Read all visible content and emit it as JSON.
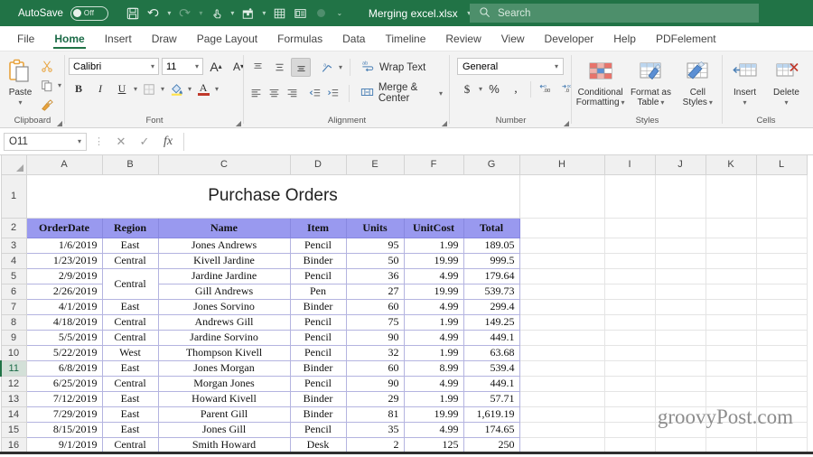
{
  "titlebar": {
    "autosave_label": "AutoSave",
    "autosave_state": "Off",
    "document_title": "Merging excel.xlsx",
    "quick_access": [
      {
        "name": "save-icon",
        "glyph": "὚B"
      },
      {
        "name": "undo-icon",
        "glyph": "↶"
      },
      {
        "name": "redo-icon",
        "glyph": "↷"
      },
      {
        "name": "touch-mode-icon",
        "glyph": "☝"
      },
      {
        "name": "new-sheet-icon",
        "glyph": "▦"
      },
      {
        "name": "table-icon",
        "glyph": "▤"
      },
      {
        "name": "form-icon",
        "glyph": "▥"
      },
      {
        "name": "record-icon",
        "glyph": "●"
      },
      {
        "name": "customize-quick-access-icon",
        "glyph": "⌄"
      }
    ],
    "search_placeholder": "Search",
    "brand_color": "#217346"
  },
  "tabs": [
    {
      "label": "File",
      "active": false
    },
    {
      "label": "Home",
      "active": true
    },
    {
      "label": "Insert",
      "active": false
    },
    {
      "label": "Draw",
      "active": false
    },
    {
      "label": "Page Layout",
      "active": false
    },
    {
      "label": "Formulas",
      "active": false
    },
    {
      "label": "Data",
      "active": false
    },
    {
      "label": "Timeline",
      "active": false
    },
    {
      "label": "Review",
      "active": false
    },
    {
      "label": "View",
      "active": false
    },
    {
      "label": "Developer",
      "active": false
    },
    {
      "label": "Help",
      "active": false
    },
    {
      "label": "PDFelement",
      "active": false
    }
  ],
  "ribbon": {
    "clipboard": {
      "label": "Clipboard",
      "paste_label": "Paste",
      "cut_label": "Cut",
      "copy_label": "Copy",
      "format_painter_label": "Format Painter"
    },
    "font": {
      "label": "Font",
      "font_name": "Calibri",
      "font_size": "11",
      "grow_font": "A",
      "shrink_font": "A",
      "bold": "B",
      "italic": "I",
      "underline": "U",
      "borders": "Borders",
      "fill_color": "Fill Color",
      "font_color": "A"
    },
    "alignment": {
      "label": "Alignment",
      "wrap_text_label": "Wrap Text",
      "merge_center_label": "Merge & Center"
    },
    "number": {
      "label": "Number",
      "format": "General",
      "currency": "$",
      "percent": "%",
      "comma": ",",
      "increase_decimal": "Increase Decimal",
      "decrease_decimal": "Decrease Decimal"
    },
    "styles": {
      "label": "Styles",
      "conditional_formatting": "Conditional\nFormatting",
      "conditional_line1": "Conditional",
      "conditional_line2": "Formatting",
      "format_as_table_line1": "Format as",
      "format_as_table_line2": "Table",
      "cell_styles_line1": "Cell",
      "cell_styles_line2": "Styles"
    },
    "cells": {
      "label": "Cells",
      "insert_label": "Insert",
      "delete_label": "Delete"
    }
  },
  "formula_bar": {
    "name_box": "O11",
    "cancel_icon": "✕",
    "enter_icon": "✓",
    "function_icon": "fx",
    "formula_value": ""
  },
  "grid": {
    "columns": [
      "A",
      "B",
      "C",
      "D",
      "E",
      "F",
      "G",
      "H",
      "I",
      "J",
      "K",
      "L"
    ],
    "rows": [
      "1",
      "2",
      "3",
      "4",
      "5",
      "6",
      "7",
      "8",
      "9",
      "10",
      "11",
      "12",
      "13",
      "14",
      "15",
      "16"
    ],
    "selected_row": "11",
    "sheet_title": "Purchase Orders",
    "headers": [
      "OrderDate",
      "Region",
      "Name",
      "Item",
      "Units",
      "UnitCost",
      "Total"
    ],
    "header_bg": "#9999ef",
    "merged_region_note": "Central",
    "data": [
      {
        "row": "3",
        "OrderDate": "1/6/2019",
        "Region": "East",
        "Name": "Jones Andrews",
        "Item": "Pencil",
        "Units": "95",
        "UnitCost": "1.99",
        "Total": "189.05"
      },
      {
        "row": "4",
        "OrderDate": "1/23/2019",
        "Region": "Central",
        "Name": "Kivell Jardine",
        "Item": "Binder",
        "Units": "50",
        "UnitCost": "19.99",
        "Total": "999.5"
      },
      {
        "row": "5",
        "OrderDate": "2/9/2019",
        "Region": "Central",
        "Name": "Jardine Jardine",
        "Item": "Pencil",
        "Units": "36",
        "UnitCost": "4.99",
        "Total": "179.64"
      },
      {
        "row": "6",
        "OrderDate": "2/26/2019",
        "Region": "",
        "Name": "Gill Andrews",
        "Item": "Pen",
        "Units": "27",
        "UnitCost": "19.99",
        "Total": "539.73"
      },
      {
        "row": "7",
        "OrderDate": "4/1/2019",
        "Region": "East",
        "Name": "Jones Sorvino",
        "Item": "Binder",
        "Units": "60",
        "UnitCost": "4.99",
        "Total": "299.4"
      },
      {
        "row": "8",
        "OrderDate": "4/18/2019",
        "Region": "Central",
        "Name": "Andrews Gill",
        "Item": "Pencil",
        "Units": "75",
        "UnitCost": "1.99",
        "Total": "149.25"
      },
      {
        "row": "9",
        "OrderDate": "5/5/2019",
        "Region": "Central",
        "Name": "Jardine Sorvino",
        "Item": "Pencil",
        "Units": "90",
        "UnitCost": "4.99",
        "Total": "449.1"
      },
      {
        "row": "10",
        "OrderDate": "5/22/2019",
        "Region": "West",
        "Name": "Thompson Kivell",
        "Item": "Pencil",
        "Units": "32",
        "UnitCost": "1.99",
        "Total": "63.68"
      },
      {
        "row": "11",
        "OrderDate": "6/8/2019",
        "Region": "East",
        "Name": "Jones Morgan",
        "Item": "Binder",
        "Units": "60",
        "UnitCost": "8.99",
        "Total": "539.4"
      },
      {
        "row": "12",
        "OrderDate": "6/25/2019",
        "Region": "Central",
        "Name": "Morgan Jones",
        "Item": "Pencil",
        "Units": "90",
        "UnitCost": "4.99",
        "Total": "449.1"
      },
      {
        "row": "13",
        "OrderDate": "7/12/2019",
        "Region": "East",
        "Name": "Howard Kivell",
        "Item": "Binder",
        "Units": "29",
        "UnitCost": "1.99",
        "Total": "57.71"
      },
      {
        "row": "14",
        "OrderDate": "7/29/2019",
        "Region": "East",
        "Name": "Parent Gill",
        "Item": "Binder",
        "Units": "81",
        "UnitCost": "19.99",
        "Total": "1,619.19"
      },
      {
        "row": "15",
        "OrderDate": "8/15/2019",
        "Region": "East",
        "Name": "Jones Gill",
        "Item": "Pencil",
        "Units": "35",
        "UnitCost": "4.99",
        "Total": "174.65"
      },
      {
        "row": "16",
        "OrderDate": "9/1/2019",
        "Region": "Central",
        "Name": "Smith Howard",
        "Item": "Desk",
        "Units": "2",
        "UnitCost": "125",
        "Total": "250"
      }
    ]
  },
  "watermark": "groovyPost.com"
}
